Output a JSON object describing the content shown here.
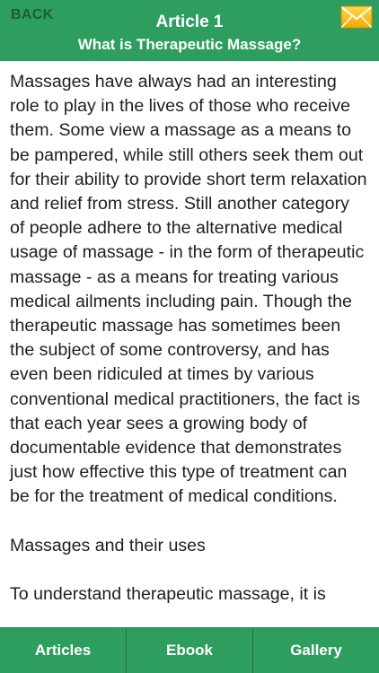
{
  "header": {
    "back_label": "BACK",
    "title": "Article 1",
    "subtitle": "What is Therapeutic Massage?",
    "mail_icon": "mail-envelope-icon",
    "accent_color": "#2e9e5f"
  },
  "article": {
    "paragraph_1": "Massages have always had an interesting role to play in the lives of those who receive them. Some view a massage as a means to be pampered, while still others seek them out for their ability to provide short term relaxation and relief from stress. Still another category of people adhere to the alternative medical usage of massage - in the form of therapeutic massage - as a means for treating various medical ailments including pain. Though the therapeutic massage has sometimes been the subject of some controversy, and has even been ridiculed at times by various conventional medical practitioners, the fact is that each year sees a growing body of documentable evidence that demonstrates just how effective this type of treatment can be for the treatment of medical conditions.",
    "heading_1": "Massages and their uses",
    "paragraph_2": "To understand therapeutic massage, it is"
  },
  "tabbar": {
    "tabs": [
      {
        "label": "Articles"
      },
      {
        "label": "Ebook"
      },
      {
        "label": "Gallery"
      }
    ]
  }
}
